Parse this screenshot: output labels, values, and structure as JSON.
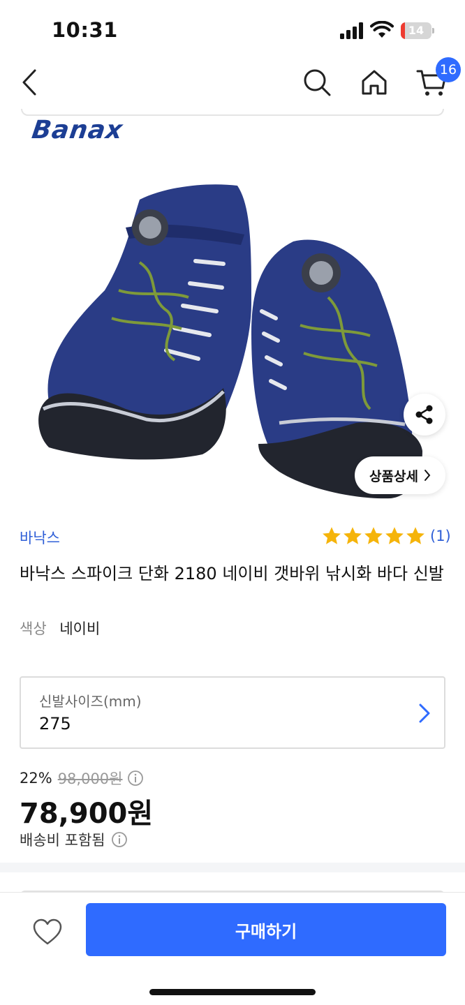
{
  "status_bar": {
    "time": "10:31",
    "battery": "14",
    "battery_level": 0.14,
    "battery_color": "#ee3b30"
  },
  "nav": {
    "cart_count": "16",
    "accent": "#2f6bff"
  },
  "hero": {
    "brand_logo": "Banax",
    "detail_label": "상품상세"
  },
  "product": {
    "brand": "바낙스",
    "rating_stars": 5,
    "review_count": "(1)",
    "star_color": "#f5b40a",
    "title": "바낙스 스파이크 단화 2180 네이비 갯바위 낚시화 바다 신발",
    "color_label": "색상",
    "color_value": "네이비"
  },
  "option": {
    "label": "신발사이즈(mm)",
    "value": "275"
  },
  "price": {
    "discount_rate": "22%",
    "original_price": "98,000원",
    "sale_price": "78,900원",
    "shipping": "배송비 포함됨"
  },
  "bottom_bar": {
    "buy_label": "구매하기"
  },
  "icons": {
    "back": "chevron-left-icon",
    "search": "search-icon",
    "home": "home-icon",
    "cart": "cart-icon",
    "share": "share-icon",
    "wish": "heart-icon",
    "info": "info-icon"
  }
}
